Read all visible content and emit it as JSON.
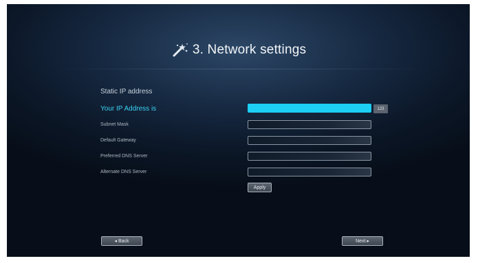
{
  "header": {
    "title": "3. Network settings",
    "icon": "magic-wand-icon"
  },
  "section": {
    "label": "Static IP address"
  },
  "rows": [
    {
      "label": "Your IP Address is",
      "value": ""
    },
    {
      "label": "Subnet Mask",
      "value": ""
    },
    {
      "label": "Default Gateway",
      "value": ""
    },
    {
      "label": "Preferred DNS Server",
      "value": ""
    },
    {
      "label": "Alternate DNS Server",
      "value": ""
    }
  ],
  "keyboard_badge": "123",
  "buttons": {
    "apply": "Apply",
    "back": "◂ Back",
    "next": "Next ▸"
  },
  "colors": {
    "accent": "#1ccff3",
    "highlight_text": "#3ad2f5",
    "background": "#0b1626"
  }
}
